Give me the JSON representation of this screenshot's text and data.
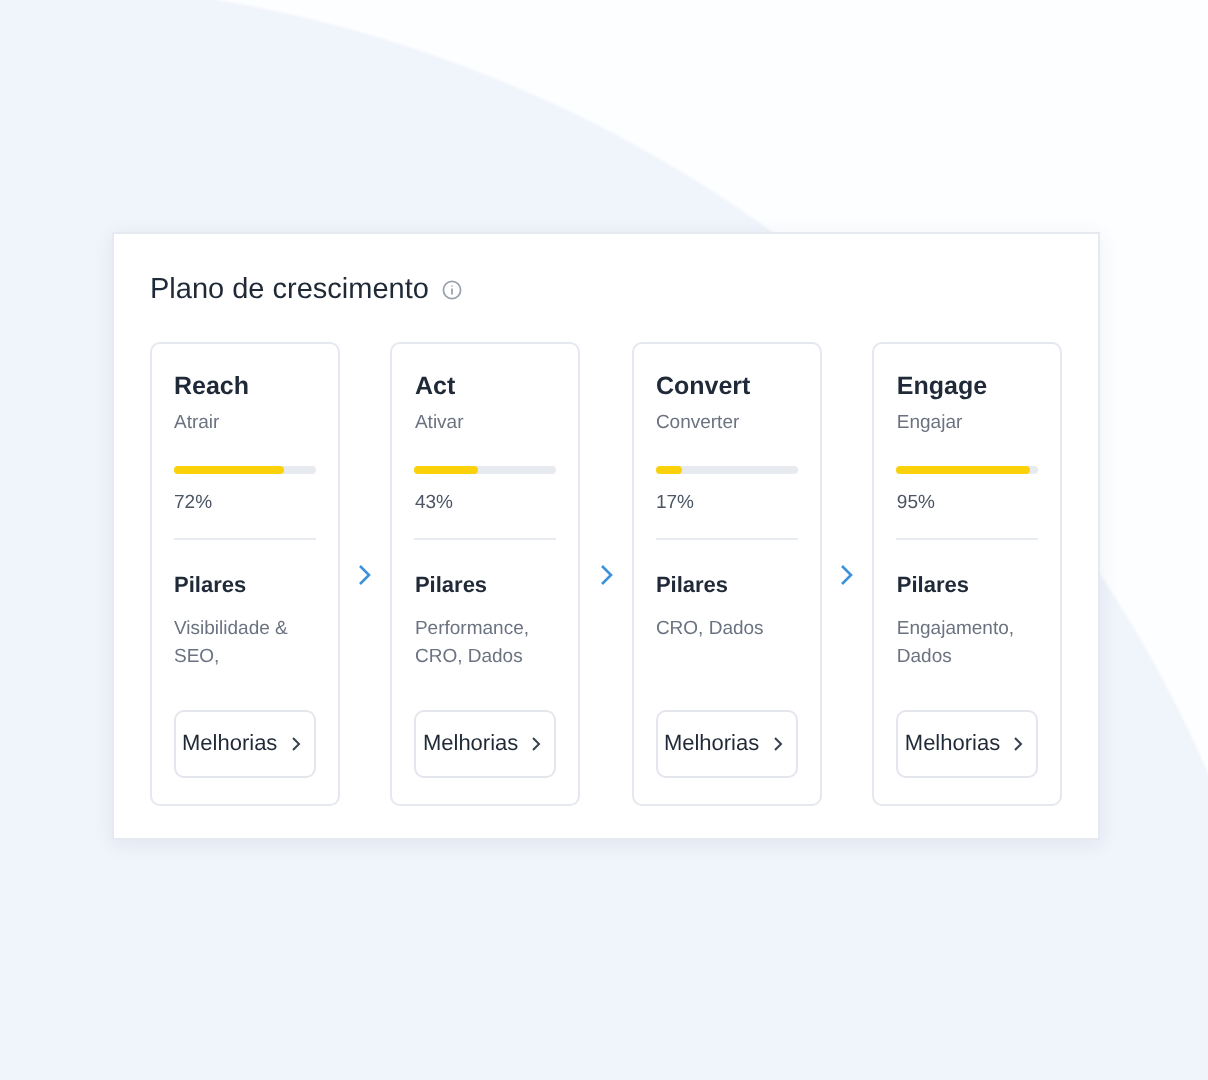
{
  "panel": {
    "title": "Plano de crescimento"
  },
  "stages": [
    {
      "name": "Reach",
      "subtitle": "Atrair",
      "level": 0.78,
      "percent": "72%",
      "pillars_label": "Pilares",
      "pillars": "Visibilidade & SEO,",
      "button": "Melhorias"
    },
    {
      "name": "Act",
      "subtitle": "Ativar",
      "level": 0.45,
      "percent": "43%",
      "pillars_label": "Pilares",
      "pillars": "Performance, CRO, Dados",
      "button": "Melhorias"
    },
    {
      "name": "Convert",
      "subtitle": "Converter",
      "level": 0.19,
      "percent": "17%",
      "pillars_label": "Pilares",
      "pillars": "CRO, Dados",
      "button": "Melhorias"
    },
    {
      "name": "Engage",
      "subtitle": "Engajar",
      "level": 0.94,
      "percent": "95%",
      "pillars_label": "Pilares",
      "pillars": "Engajamento, Dados",
      "button": "Melhorias"
    }
  ]
}
